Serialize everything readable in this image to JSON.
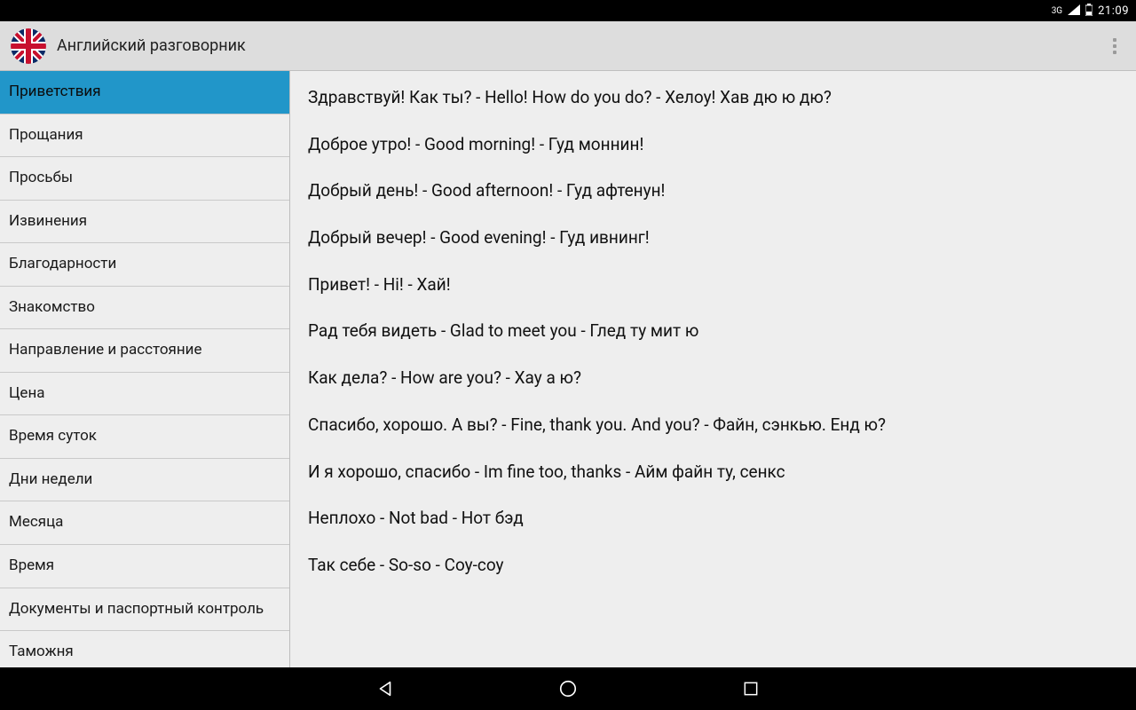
{
  "status": {
    "network": "3G",
    "time": "21:09"
  },
  "appbar": {
    "title": "Английский разговорник"
  },
  "sidebar": {
    "items": [
      "Приветствия",
      "Прощания",
      "Просьбы",
      "Извинения",
      "Благодарности",
      "Знакомство",
      "Направление и расстояние",
      "Цена",
      "Время суток",
      "Дни недели",
      "Месяца",
      "Время",
      "Документы и паспортный контроль",
      "Таможня"
    ],
    "active_index": 0
  },
  "phrases": [
    "Здравствуй! Как ты? - Hello! How do you do? - Хелоу! Хав дю ю дю?",
    "Доброе утро! - Good morning! - Гуд моннин!",
    "Добрый день! - Good afternoon! - Гуд афтенун!",
    "Добрый вечер! - Good evening! - Гуд ивнинг!",
    "Привет! - Hi! - Хай!",
    "Рад тебя видеть - Glad to meet you - Глед ту мит ю",
    "Как дела? - How are you? - Хау а ю?",
    "Спасибо, хорошо. А вы? - Fine, thank you. And you? - Файн, сэнкью. Енд ю?",
    "И я хорошо, спасибо - Im fine too, thanks - Айм файн ту, сенкс",
    "Неплохо - Not bad - Нот бэд",
    "Так себе - So-so - Соу-соу"
  ]
}
